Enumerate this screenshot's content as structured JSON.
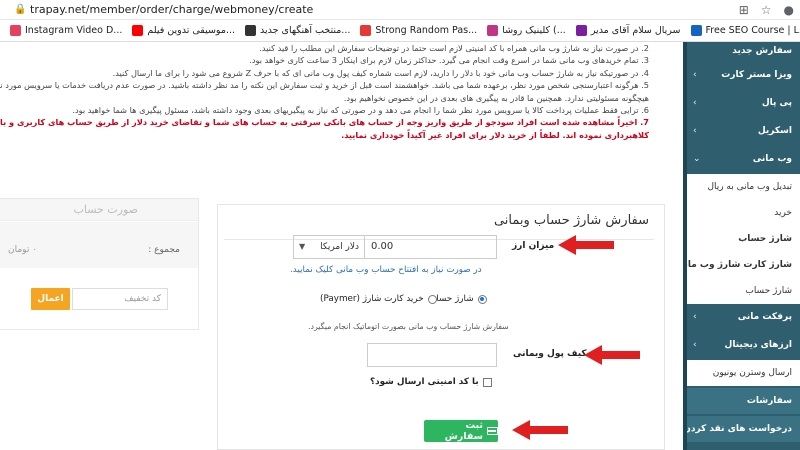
{
  "browser": {
    "url": "trapay.net/member/order/charge/webmoney/create",
    "bookmarks": [
      {
        "label": "Instagram Video D...",
        "color": "#e4405f"
      },
      {
        "label": "موسیقی تدوین فیلم...",
        "color": "#ff0000"
      },
      {
        "label": "منتخب آهنگهای جدید...",
        "color": "#333333"
      },
      {
        "label": "Strong Random Pas...",
        "color": "#e53935"
      },
      {
        "label": "کلینیک روشا (...",
        "color": "#c13584"
      },
      {
        "label": "سریال سلام آقای مدیر",
        "color": "#7b1fa2"
      },
      {
        "label": "Free SEO Course | L...",
        "color": "#1565c0"
      }
    ]
  },
  "notes": [
    {
      "num": "2.",
      "text": "در صورت نیاز به شارژ وب مانی همراه با کد امنیتی لازم است حتما در توضیحات سفارش این مطلب را قید کنید.",
      "red": false
    },
    {
      "num": "3.",
      "text": "تمام خریدهای وب مانی شما در اسرع وقت انجام می گیرد. حداکثر زمان لازم برای اینکار 3 ساعت کاری خواهد بود.",
      "red": false
    },
    {
      "num": "4.",
      "text": "در صورتیکه نیاز به شارژ حساب وب مانی خود با دلار را دارید، لازم است شماره کیف پول وب مانی ای که با حرف Z شروع می شود را برای ما ارسال کنید.",
      "red": false
    },
    {
      "num": "5.",
      "text": "هرگونه اعتبارسنجی شخص مورد نظر، برعهده شما می باشد. خواهشمند است قبل از خرید و ثبت سفارش این نکته را مد نظر داشته باشید. در صورت عدم دریافت خدمات یا سرویس مورد نظرتان، ترا",
      "red": false
    },
    {
      "num": "",
      "text": "هیچگونه مسئولیتی ندارد. همچنین ما قادر به پیگیری های بعدی در این خصوص نخواهیم بود.",
      "red": false
    },
    {
      "num": "6.",
      "text": "ترایی فقط عملیات پرداخت کالا یا سرویس مورد نظر شما را انجام می دهد و در صورتی که نیاز به پیگیریهای بعدی وجود داشته باشد، مسئول پیگیری ها شما خواهید بود.",
      "red": false
    },
    {
      "num": "7.",
      "text": "اخیراً مشاهده شده است افراد سودجو از طریق واریز وجه از حساب های بانکی سرقتی به حساب های شما و تقاضای خرید دلار از طریق حساب های کاربری و بانکی تایید شده شما در این سایت، اقدام به",
      "red": true
    },
    {
      "num": "",
      "text": "کلاهبرداری نموده اند. لطفاً از خرید دلار برای افراد غیر آکیداً خودداری نمایید.",
      "red": true
    }
  ],
  "sidebar": {
    "items": [
      {
        "label": "سفارش جدید",
        "type": "item",
        "chev": ""
      },
      {
        "label": "ویزا مستر کارت",
        "type": "item",
        "chev": "‹"
      },
      {
        "label": "پی پال",
        "type": "item",
        "chev": "‹"
      },
      {
        "label": "اسکریل",
        "type": "item",
        "chev": "‹"
      },
      {
        "label": "وب مانی",
        "type": "item",
        "chev": "⌄"
      },
      {
        "label": "تبدیل وب مانی به ریال",
        "type": "sub",
        "chev": ""
      },
      {
        "label": "خرید",
        "type": "sub",
        "chev": ""
      },
      {
        "label": "شارژ حساب",
        "type": "sub-bold",
        "chev": ""
      },
      {
        "label": "شارژ کارت شارژ وب مانی",
        "type": "sub-bold",
        "chev": ""
      },
      {
        "label": "شارژ حساب",
        "type": "sub",
        "chev": ""
      },
      {
        "label": "پرفکت مانی",
        "type": "item",
        "chev": "‹"
      },
      {
        "label": "ارزهای دیجیتال",
        "type": "item",
        "chev": "‹"
      },
      {
        "label": "ارسال وسترن یونیون",
        "type": "sub",
        "chev": ""
      },
      {
        "label": "سفارشات",
        "type": "item-active",
        "chev": ""
      },
      {
        "label": "درخواست های نقد کردن",
        "type": "item-active",
        "chev": ""
      }
    ]
  },
  "summary": {
    "title": "صورت حساب",
    "total_label": "مجموع :",
    "total_value": "۰ تومان",
    "coupon_placeholder": "کد تخفیف",
    "apply_label": "اعمال"
  },
  "form": {
    "title": "سفارش شارژ حساب وبمانی",
    "amount_label": "میزان ارز",
    "amount_value": "0.00",
    "currency": "دلار امریکا",
    "open_account_link": "در صورت نیاز به افتتاح حساب وب مانی کلیک نمایید.",
    "radio_account": "شارژ حساب",
    "radio_card": "خرید کارت شارژ (Paymer)",
    "auto_hint": "سفارش شارژ حساب وب مانی بصورت اتوماتیک انجام میگیرد.",
    "wallet_label": "کیف پول وبمانی",
    "security_label": "با کد امنیتی ارسال شود؟",
    "submit_label": "ثبت سفارش"
  },
  "colors": {
    "sidebar_bg": "#2f5f6e",
    "submit_green": "#2eb55f",
    "apply_orange": "#f5a522",
    "arrow_red": "#e02020",
    "link_blue": "#2a6fb5",
    "warning_red": "#d0021b"
  }
}
